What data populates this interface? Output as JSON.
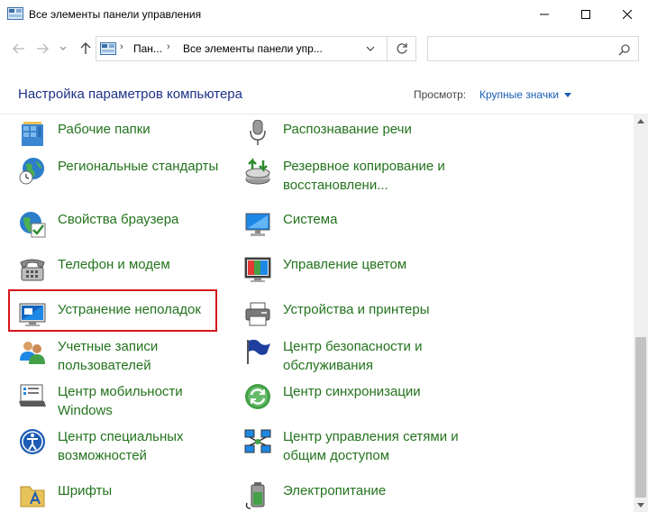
{
  "window": {
    "title": "Все элементы панели управления",
    "icon": "control-panel-icon"
  },
  "address": {
    "segments": [
      "Пан...",
      "Все элементы панели упр..."
    ],
    "search_placeholder": ""
  },
  "header": {
    "heading": "Настройка параметров компьютера",
    "view_by_label": "Просмотр:",
    "view_by_value": "Крупные значки"
  },
  "items": {
    "work_folders": "Рабочие папки",
    "speech": "Распознавание речи",
    "regional": "Региональные стандарты",
    "backup": "Резервное копирование и восстановлени...",
    "internet_options": "Свойства браузера",
    "system": "Система",
    "phone_modem": "Телефон и модем",
    "color_management": "Управление цветом",
    "troubleshooting": "Устранение неполадок",
    "devices_printers": "Устройства и принтеры",
    "user_accounts": "Учетные записи пользователей",
    "security_center": "Центр безопасности и обслуживания",
    "mobility_center": "Центр мобильности Windows",
    "sync_center": "Центр синхронизации",
    "ease_of_access": "Центр специальных возможностей",
    "network_center": "Центр управления сетями и общим доступом",
    "fonts": "Шрифты",
    "power": "Электропитание"
  },
  "colors": {
    "link_green": "#23731d",
    "heading_blue": "#1e3287",
    "highlight_red": "#d4161c"
  }
}
